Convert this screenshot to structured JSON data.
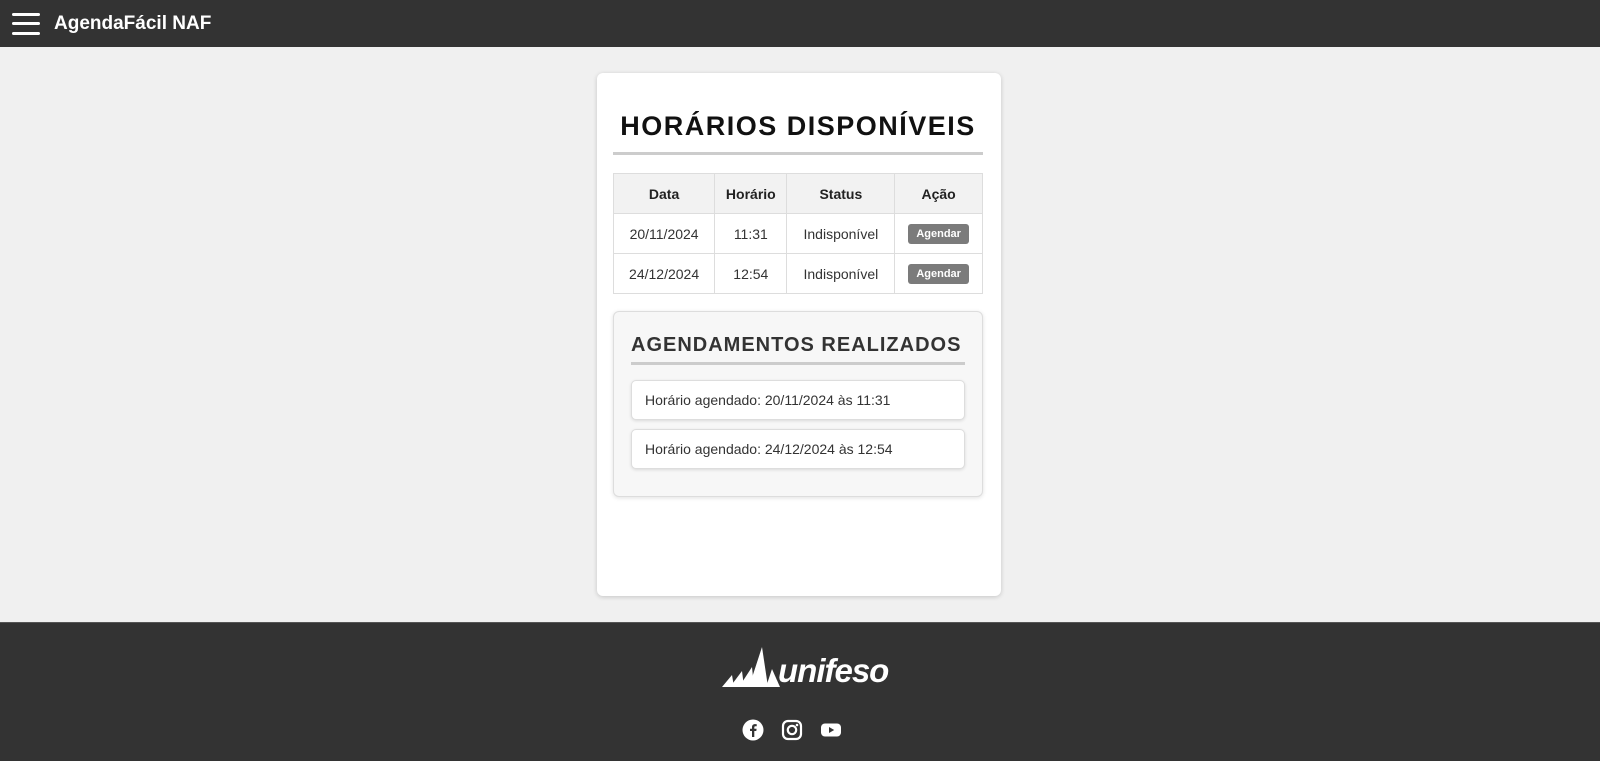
{
  "header": {
    "app_title": "AgendaFácil NAF",
    "menu_icon": "hamburger-menu-icon"
  },
  "main": {
    "title": "HORÁRIOS DISPONÍVEIS",
    "table": {
      "columns": [
        "Data",
        "Horário",
        "Status",
        "Ação"
      ],
      "rows": [
        {
          "date": "20/11/2024",
          "time": "11:31",
          "status": "Indisponível",
          "action": "Agendar"
        },
        {
          "date": "24/12/2024",
          "time": "12:54",
          "status": "Indisponível",
          "action": "Agendar"
        }
      ]
    },
    "booked": {
      "title": "AGENDAMENTOS REALIZADOS",
      "items": [
        "Horário agendado: 20/11/2024 às 11:31",
        "Horário agendado: 24/12/2024 às 12:54"
      ]
    }
  },
  "footer": {
    "logo_text": "unifeso",
    "social": [
      "facebook-icon",
      "instagram-icon",
      "youtube-icon"
    ]
  },
  "colors": {
    "header_bg": "#333333",
    "button_bg": "#7b7b7b",
    "page_bg": "#f0f0f0"
  }
}
